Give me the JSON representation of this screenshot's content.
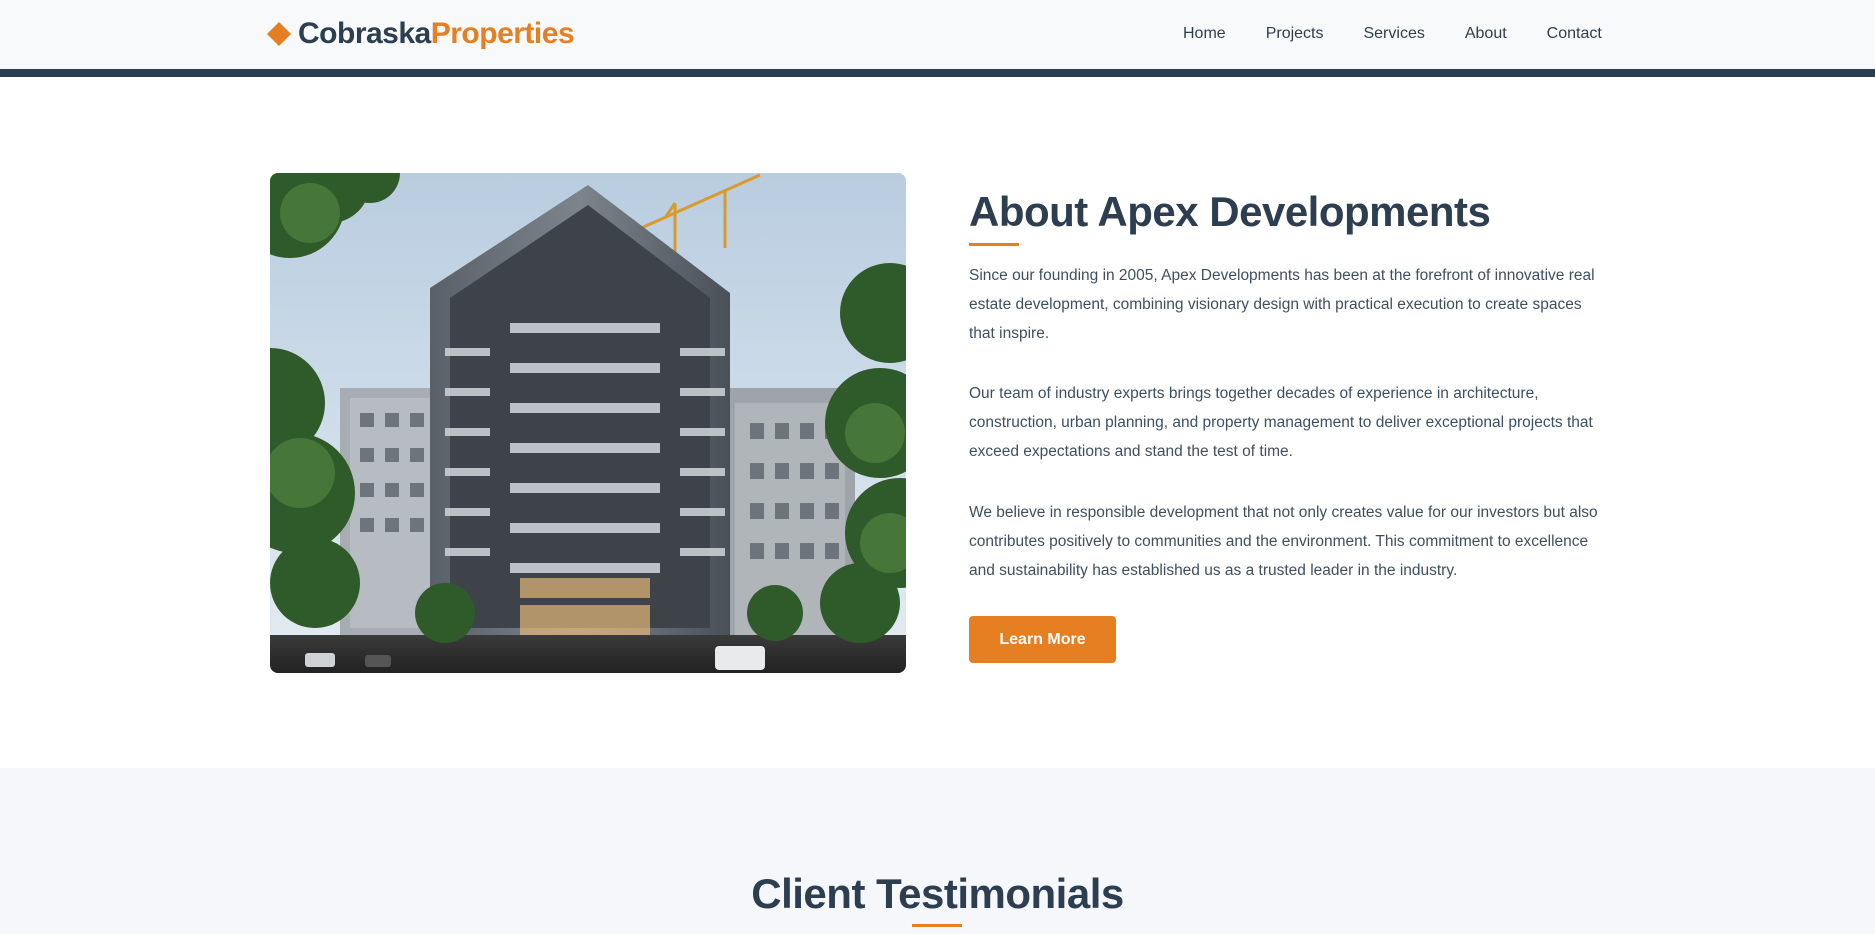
{
  "brand": {
    "name_part1": "Cobraska",
    "name_part2": "Properties",
    "icon": "diamond-icon",
    "accent_color": "#e67e22",
    "primary_color": "#2c3e50"
  },
  "nav": {
    "items": [
      {
        "label": "Home"
      },
      {
        "label": "Projects"
      },
      {
        "label": "Services"
      },
      {
        "label": "About"
      },
      {
        "label": "Contact"
      }
    ]
  },
  "about": {
    "image_subject": "modern apartment building under construction with crane",
    "title": "About Apex Developments",
    "paragraphs": [
      "Since our founding in 2005, Apex Developments has been at the forefront of innovative real estate development, combining visionary design with practical execution to create spaces that inspire.",
      "Our team of industry experts brings together decades of experience in architecture, construction, urban planning, and property management to deliver exceptional projects that exceed expectations and stand the test of time.",
      "We believe in responsible development that not only creates value for our investors but also contributes positively to communities and the environment. This commitment to excellence and sustainability has established us as a trusted leader in the industry."
    ],
    "button_label": "Learn More"
  },
  "testimonials": {
    "title": "Client Testimonials"
  }
}
